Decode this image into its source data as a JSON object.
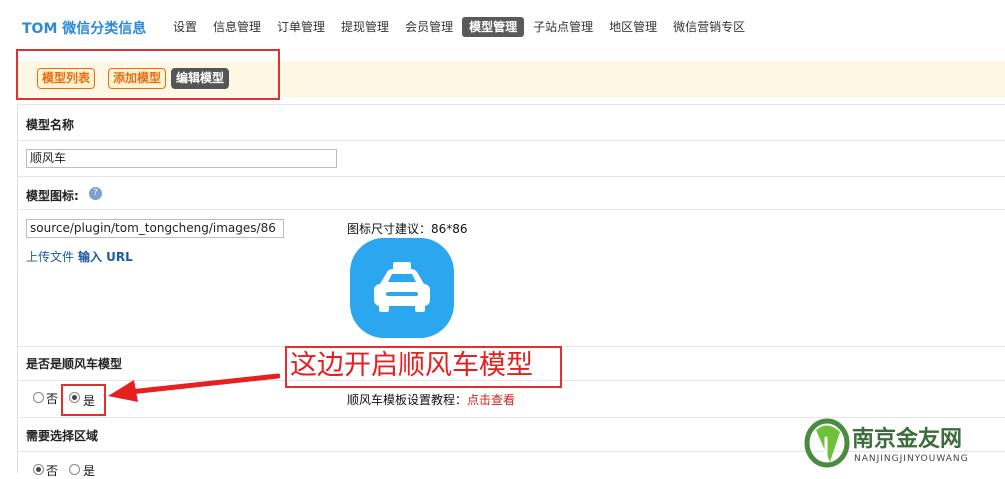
{
  "brand": "TOM 微信分类信息",
  "nav": [
    {
      "label": "设置"
    },
    {
      "label": "信息管理"
    },
    {
      "label": "订单管理"
    },
    {
      "label": "提现管理"
    },
    {
      "label": "会员管理"
    },
    {
      "label": "模型管理",
      "active": true
    },
    {
      "label": "子站点管理"
    },
    {
      "label": "地区管理"
    },
    {
      "label": "微信营销专区"
    }
  ],
  "subtabs": [
    {
      "label": "模型列表"
    },
    {
      "label": "添加模型"
    },
    {
      "label": "编辑模型",
      "active": true
    }
  ],
  "form": {
    "model_name_label": "模型名称",
    "model_name_value": "顺风车",
    "model_icon_label": "模型图标:",
    "help_icon_glyph": "?",
    "model_icon_value": "source/plugin/tom_tongcheng/images/86",
    "upload_file_label": "上传文件",
    "input_url_label": "输入 URL",
    "icon_size_hint": "图标尺寸建议：86*86",
    "icon_preview": "car-taxi-icon",
    "icon_preview_color": "#2aa7ee",
    "is_carpool_label": "是否是顺风车模型",
    "is_carpool_no": "否",
    "is_carpool_yes": "是",
    "is_carpool_selected": "是",
    "carpool_template_hint": "顺风车模板设置教程：",
    "carpool_template_link": "点击查看",
    "need_region_label": "需要选择区域",
    "need_region_no": "否",
    "need_region_yes": "是",
    "need_region_selected": "否"
  },
  "annotation": {
    "text": "这边开启顺风车模型",
    "color": "#e62020"
  },
  "watermark": {
    "text": "南京金友网",
    "sub": "NANJINGJINYOUWANG"
  }
}
